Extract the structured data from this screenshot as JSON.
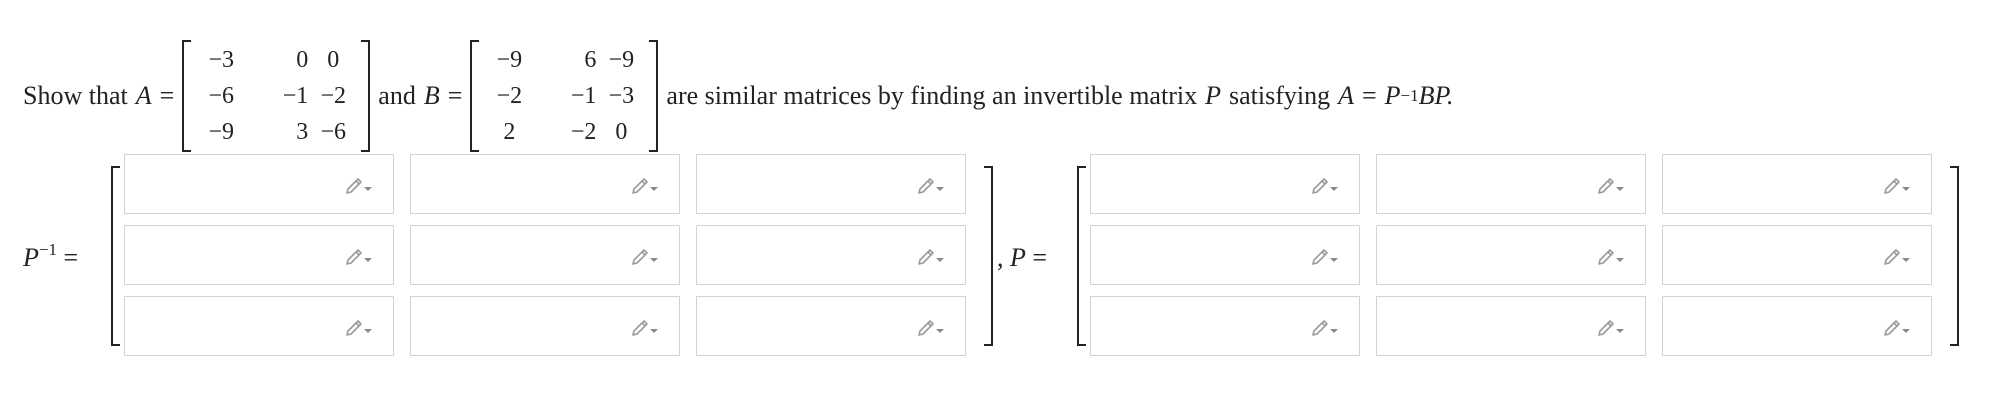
{
  "statement": {
    "show_that": "Show that",
    "a_label": "A",
    "b_label": "B",
    "equals": "=",
    "and": "and",
    "rest": "are similar matrices by finding an invertible matrix",
    "p_label": "P",
    "satisfying": "satisfying",
    "eq_a": "A",
    "eq_equals": "=",
    "eq_p": "P",
    "eq_exp": "−1",
    "eq_bp": "BP.",
    "matrix_a": [
      [
        "−3",
        "0",
        "0"
      ],
      [
        "−6",
        "−1",
        "−2"
      ],
      [
        "−9",
        "3",
        "−6"
      ]
    ],
    "matrix_b": [
      [
        "−9",
        "6",
        "−9"
      ],
      [
        "−2",
        "−1",
        "−3"
      ],
      [
        "2",
        "−2",
        "0"
      ]
    ]
  },
  "answer": {
    "pinv_label": "P",
    "pinv_exp": "−1",
    "pinv_equals": "=",
    "comma": ",",
    "p_label": "P",
    "p_equals": "=",
    "cell_icon": "pencil-edit-icon",
    "pinv_cells": [
      [
        "",
        "",
        ""
      ],
      [
        "",
        "",
        ""
      ],
      [
        "",
        "",
        ""
      ]
    ],
    "p_cells": [
      [
        "",
        "",
        ""
      ],
      [
        "",
        "",
        ""
      ],
      [
        "",
        "",
        ""
      ]
    ]
  }
}
